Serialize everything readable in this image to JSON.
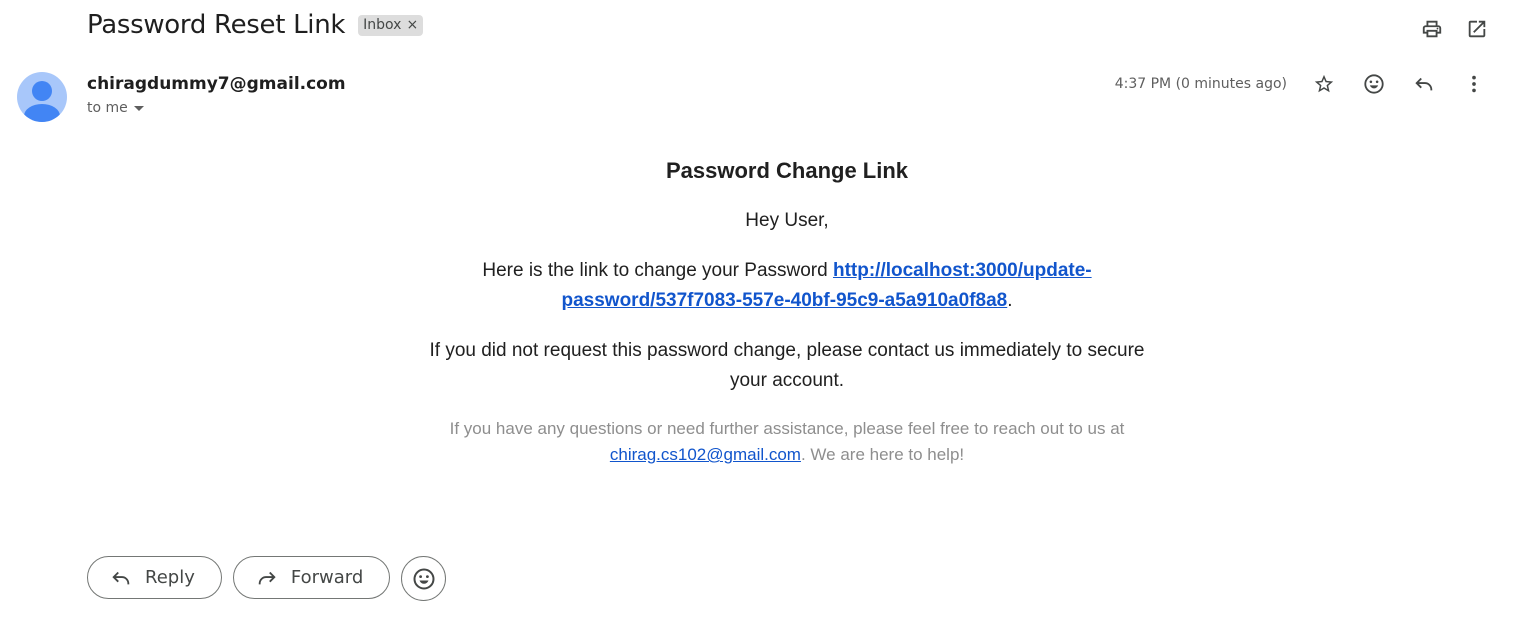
{
  "email": {
    "subject": "Password Reset Link",
    "label": "Inbox",
    "label_remove": "×",
    "sender": "chiragdummy7@gmail.com",
    "recipient": "to me",
    "timestamp": "4:37 PM (0 minutes ago)"
  },
  "top_toolbar": {
    "icons": [
      "print-icon",
      "open-in-new-window-icon"
    ]
  },
  "message_toolbar": {
    "icons": [
      "star-icon",
      "emoji-reaction-icon",
      "reply-icon",
      "more-vert-icon"
    ]
  },
  "content": {
    "heading": "Password Change Link",
    "greeting": "Hey User,",
    "link_intro": "Here is the link to change your Password",
    "link_text": "http://localhost:3000/update-password/537f7083-557e-40bf-95c9-a5a910a0f8a8",
    "link_suffix": ".",
    "warning": "If you did not request this password change, please contact us immediately to secure your account.",
    "footnote_prefix": "If you have any questions or need further assistance, please feel free to reach out to us at",
    "footnote_email": "chirag.cs102@gmail.com",
    "footnote_suffix": ". We are here to help!"
  },
  "actions": {
    "reply_label": "Reply",
    "forward_label": "Forward"
  },
  "colors": {
    "link": "#1155cc",
    "avatar_bg": "#a8c7fa",
    "avatar_fg": "#4285f4",
    "muted": "#8e8e8e"
  }
}
